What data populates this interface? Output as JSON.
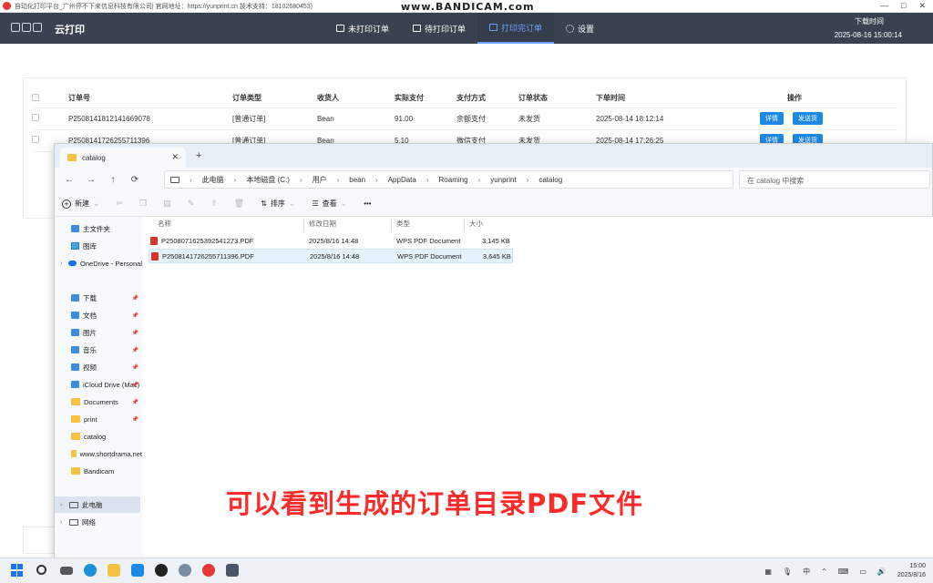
{
  "app": {
    "title_bar": "自动化打印平台_广州停不下来信息科技有限公司| 官网地址：https://yunprint.cn 技术支持：18102680453)",
    "watermark": "www.BANDICAM.com",
    "window_controls": [
      "—",
      "□",
      "✕"
    ],
    "brand_name": "云打印",
    "nav": [
      {
        "label": "未打印订单",
        "icon": "printer-icon"
      },
      {
        "label": "待打印订单",
        "icon": "printer-icon"
      },
      {
        "label": "打印完订单",
        "icon": "printer-icon",
        "active": true
      },
      {
        "label": "设置",
        "icon": "gear-icon"
      }
    ],
    "download_time_label": "下载时间",
    "download_time_value": "2025-08-16 15:00:14"
  },
  "orders": {
    "columns": [
      "订单号",
      "订单类型",
      "收货人",
      "实际支付",
      "支付方式",
      "订单状态",
      "下单时间",
      "操作"
    ],
    "rows": [
      {
        "id": "P2508141812141669078",
        "type": "[普通订单]",
        "receiver": "Bean",
        "paid": "91.00",
        "method": "余额支付",
        "status": "未发货",
        "time": "2025-08-14 18:12:14"
      },
      {
        "id": "P2508141726255711396",
        "type": "[普通订单]",
        "receiver": "Bean",
        "paid": "5.10",
        "method": "微信支付",
        "status": "未发货",
        "time": "2025-08-14 17:26:25"
      }
    ],
    "detail_btn": "详情",
    "ship_btn": "发送货"
  },
  "explorer": {
    "tab_title": "catalog",
    "tab_close": "✕",
    "new_tab": "+",
    "nav_buttons": [
      "←",
      "→",
      "↑",
      "⟳"
    ],
    "breadcrumb": [
      "此电脑",
      "本地磁盘 (C:)",
      "用户",
      "bean",
      "AppData",
      "Roaming",
      "yunprint",
      "catalog"
    ],
    "search_placeholder": "在 catalog 中搜索",
    "toolbar": {
      "new": "新建",
      "sort": "排序",
      "view": "查看",
      "more": "•••"
    },
    "sidebar": [
      {
        "label": "主文件夹",
        "icon": "home-icon"
      },
      {
        "label": "图库",
        "icon": "gallery-icon"
      },
      {
        "label": "OneDrive - Personal",
        "icon": "cloud-icon",
        "chev": true
      },
      {
        "label": "下载",
        "icon": "download-folder-icon",
        "pinned": true
      },
      {
        "label": "文档",
        "icon": "documents-folder-icon",
        "pinned": true
      },
      {
        "label": "图片",
        "icon": "pictures-folder-icon",
        "pinned": true
      },
      {
        "label": "音乐",
        "icon": "music-folder-icon",
        "pinned": true
      },
      {
        "label": "视频",
        "icon": "videos-folder-icon",
        "pinned": true
      },
      {
        "label": "iCloud Drive (Mac)",
        "icon": "icloud-folder-icon",
        "pinned": true
      },
      {
        "label": "Documents",
        "icon": "folder-icon",
        "pinned": true
      },
      {
        "label": "print",
        "icon": "folder-icon",
        "pinned": true
      },
      {
        "label": "catalog",
        "icon": "folder-icon"
      },
      {
        "label": "www.shortdrama.net",
        "icon": "folder-icon"
      },
      {
        "label": "Bandicam",
        "icon": "folder-icon"
      },
      {
        "label": "此电脑",
        "icon": "pc-icon",
        "chev": true,
        "selected": true
      },
      {
        "label": "网络",
        "icon": "network-icon",
        "chev": true
      }
    ],
    "columns": {
      "name": "名称",
      "modified": "修改日期",
      "type": "类型",
      "size": "大小"
    },
    "files": [
      {
        "name": "P2508071625392541273.PDF",
        "modified": "2025/8/16 14:48",
        "type": "WPS PDF Document",
        "size": "3,145 KB"
      },
      {
        "name": "P2508141726255711396.PDF",
        "modified": "2025/8/16 14:48",
        "type": "WPS PDF Document",
        "size": "3,645 KB"
      }
    ]
  },
  "subtitle": "可以看到生成的订单目录PDF文件",
  "taskbar": {
    "tray": {
      "input_mode": "中",
      "time": "15:00",
      "date": "2025/8/16"
    }
  }
}
